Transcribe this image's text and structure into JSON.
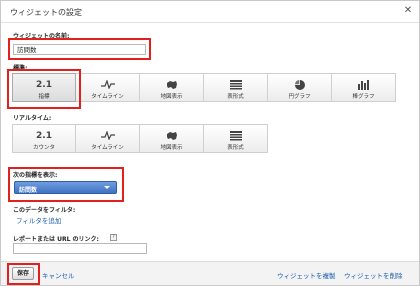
{
  "dialog": {
    "title": "ウィジェットの設定",
    "close_glyph": "✕"
  },
  "name_section": {
    "label": "ウィジェットの名前:",
    "value": "訪問数"
  },
  "standard": {
    "label": "標準:",
    "buttons": [
      {
        "top": "2.1",
        "caption": "指標",
        "icon": "metric-number",
        "selected": true
      },
      {
        "top": "",
        "caption": "タイムライン",
        "icon": "timeline-icon",
        "selected": false
      },
      {
        "top": "",
        "caption": "地図表示",
        "icon": "map-icon",
        "selected": false
      },
      {
        "top": "",
        "caption": "表形式",
        "icon": "table-icon",
        "selected": false
      },
      {
        "top": "",
        "caption": "円グラフ",
        "icon": "pie-icon",
        "selected": false
      },
      {
        "top": "",
        "caption": "棒グラフ",
        "icon": "bar-icon",
        "selected": false
      }
    ]
  },
  "realtime": {
    "label": "リアルタイム:",
    "buttons": [
      {
        "top": "2.1",
        "caption": "カウンタ",
        "icon": "metric-number"
      },
      {
        "top": "",
        "caption": "タイムライン",
        "icon": "timeline-icon"
      },
      {
        "top": "",
        "caption": "地図表示",
        "icon": "map-icon"
      },
      {
        "top": "",
        "caption": "表形式",
        "icon": "table-icon"
      }
    ]
  },
  "metric_section": {
    "label": "次の指標を表示:",
    "selected": "訪問数"
  },
  "filter_section": {
    "label": "このデータをフィルタ:",
    "link": "フィルタを追加"
  },
  "report_link_section": {
    "label": "レポートまたは URL のリンク:",
    "help_glyph": "?",
    "value": ""
  },
  "footer": {
    "save": "保存",
    "cancel": "キャンセル",
    "clone": "ウィジェットを複製",
    "delete": "ウィジェットを削除"
  },
  "colors": {
    "highlight": "#e0211d",
    "dropdown": "#4a7dcf",
    "link": "#1a5dab"
  }
}
